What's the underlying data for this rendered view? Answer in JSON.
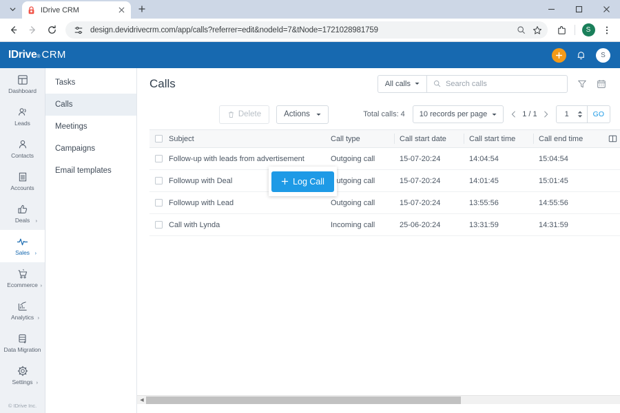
{
  "browser": {
    "tab": {
      "title": "IDrive CRM",
      "favicon_icon": "lock-red-icon",
      "close_icon": "close-icon"
    },
    "new_tab_icon": "plus-icon",
    "tab_list_icon": "chevron-down-icon",
    "window_controls": {
      "minimize": "minimize-icon",
      "maximize": "maximize-icon",
      "close": "close-icon"
    },
    "nav": {
      "back_icon": "arrow-back-icon",
      "forward_icon": "arrow-forward-icon",
      "reload_icon": "reload-icon"
    },
    "omnibox": {
      "site_settings_icon": "tune-icon",
      "url": "design.devidrivecrm.com/app/calls?referrer=edit&nodeId=7&tNode=1721028981759",
      "search_icon": "search-icon",
      "bookmark_icon": "star-icon"
    },
    "toolbar_right": {
      "extensions_icon": "extensions-puzzle-icon",
      "profile_initial": "S",
      "menu_icon": "more-vertical-icon"
    }
  },
  "app_header": {
    "logo_main": "IDriv",
    "logo_e": "e",
    "logo_registered": "®",
    "logo_crm": "CRM",
    "add_icon": "plus-circle-icon",
    "notification_icon": "bell-icon",
    "avatar_initial": "S",
    "bg_color": "#1769b0",
    "add_color": "#f49a18"
  },
  "nav_rail": {
    "items": [
      {
        "label": "Dashboard",
        "icon": "dashboard-grid-icon",
        "active": false,
        "caret": ""
      },
      {
        "label": "Leads",
        "icon": "leads-people-icon",
        "active": false,
        "caret": ""
      },
      {
        "label": "Contacts",
        "icon": "contact-person-icon",
        "active": false,
        "caret": ""
      },
      {
        "label": "Accounts",
        "icon": "accounts-building-icon",
        "active": false,
        "caret": ""
      },
      {
        "label": "Deals",
        "icon": "deals-thumbsup-icon",
        "active": false,
        "caret": "›"
      },
      {
        "label": "Sales",
        "icon": "sales-pulse-icon",
        "active": true,
        "caret": "›"
      },
      {
        "label": "Ecommerce",
        "icon": "ecommerce-cart-icon",
        "active": false,
        "caret": "›"
      },
      {
        "label": "Analytics",
        "icon": "analytics-chart-icon",
        "active": false,
        "caret": "›"
      },
      {
        "label": "Data Migration",
        "icon": "data-migration-icon",
        "active": false,
        "caret": ""
      },
      {
        "label": "Settings",
        "icon": "settings-gear-icon",
        "active": false,
        "caret": "›"
      }
    ],
    "footer": "© IDrive Inc.",
    "active_color": "#1769b0"
  },
  "sub_nav": {
    "items": [
      {
        "label": "Tasks",
        "active": false
      },
      {
        "label": "Calls",
        "active": true
      },
      {
        "label": "Meetings",
        "active": false
      },
      {
        "label": "Campaigns",
        "active": false
      },
      {
        "label": "Email templates",
        "active": false
      }
    ]
  },
  "content_header": {
    "title": "Calls",
    "filter_select": {
      "label": "All calls",
      "caret_icon": "caret-down-icon"
    },
    "search": {
      "placeholder": "Search calls",
      "value": "",
      "icon": "search-icon"
    },
    "filter_icon": "funnel-filter-icon",
    "calendar_icon": "calendar-icon"
  },
  "action_bar": {
    "log_call": {
      "label": "Log Call",
      "icon": "plus-icon",
      "color": "#1e9ae6"
    },
    "delete": {
      "label": "Delete",
      "icon": "trash-icon",
      "disabled": true
    },
    "actions": {
      "label": "Actions",
      "caret_icon": "caret-down-icon"
    },
    "total_label": "Total calls: 4",
    "records_per_page": {
      "label": "10 records per page",
      "caret_icon": "caret-down-icon"
    },
    "pagination": {
      "prev_icon": "chevron-left-icon",
      "page_display": "1 / 1",
      "next_icon": "chevron-right-icon",
      "page_input_value": "1",
      "stepper_icon": "stepper-up-down-icon",
      "go_label": "GO"
    }
  },
  "table": {
    "select_all_checkbox": "checkbox-unchecked-icon",
    "columns_icon": "column-settings-icon",
    "headers": [
      "Subject",
      "Call type",
      "Call start date",
      "Call start time",
      "Call end time"
    ],
    "rows": [
      {
        "checkbox": "checkbox-unchecked-icon",
        "subject": "Follow-up with leads from advertisement",
        "call_type": "Outgoing call",
        "call_start_date": "15-07-20:24",
        "call_start_time": "14:04:54",
        "call_end_time": "15:04:54"
      },
      {
        "checkbox": "checkbox-unchecked-icon",
        "subject": "Followup with Deal",
        "call_type": "Outgoing call",
        "call_start_date": "15-07-20:24",
        "call_start_time": "14:01:45",
        "call_end_time": "15:01:45"
      },
      {
        "checkbox": "checkbox-unchecked-icon",
        "subject": "Followup with Lead",
        "call_type": "Outgoing call",
        "call_start_date": "15-07-20:24",
        "call_start_time": "13:55:56",
        "call_end_time": "14:55:56"
      },
      {
        "checkbox": "checkbox-unchecked-icon",
        "subject": "Call with Lynda",
        "call_type": "Incoming call",
        "call_start_date": "25-06-20:24",
        "call_start_time": "13:31:59",
        "call_end_time": "14:31:59"
      }
    ]
  },
  "horizontal_scrollbar": {
    "left_arrow_icon": "scroll-left-arrow-icon",
    "thumb_percent": 66.5
  }
}
